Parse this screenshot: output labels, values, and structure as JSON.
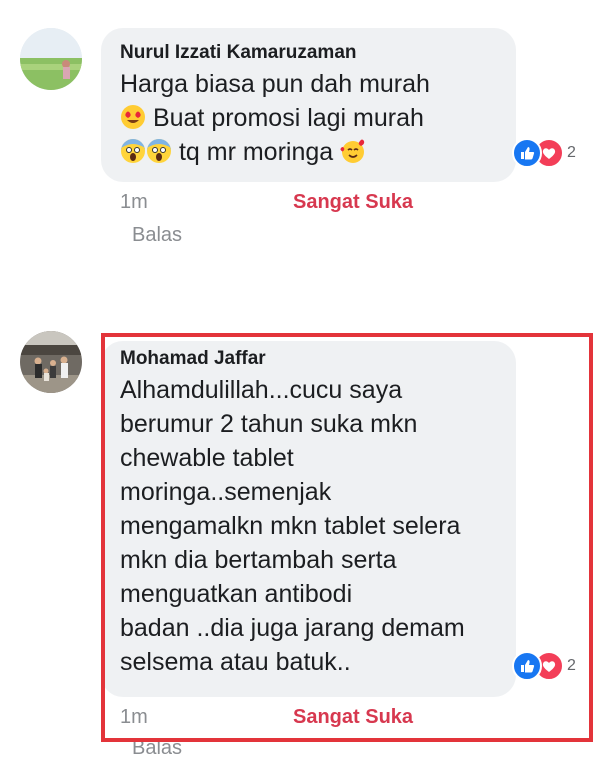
{
  "comments": [
    {
      "author": "Nurul Izzati Kamaruzaman",
      "lines": [
        "Harga biasa pun dah murah",
        "Buat promosi lagi murah",
        "tq mr moringa"
      ],
      "emojis": [
        "heart-eyes-emoji",
        "screaming-face-emoji",
        "smiling-hearts-emoji"
      ],
      "time": "1m",
      "reaction_label": "Sangat Suka",
      "reply_label": "Balas",
      "reaction_count": "2"
    },
    {
      "author": "Mohamad Jaffar",
      "lines": [
        "Alhamdulillah...cucu saya",
        "berumur 2 tahun suka mkn",
        "chewable tablet",
        "moringa..semenjak",
        "mengamalkn mkn tablet selera",
        "mkn dia bertambah serta",
        "menguatkan antibodi",
        "badan ..dia juga jarang demam",
        "selsema atau batuk.."
      ],
      "time": "1m",
      "reaction_label": "Sangat Suka",
      "reply_label": "Balas",
      "reaction_count": "2"
    }
  ],
  "colors": {
    "bubble": "#eff1f3",
    "like_blue": "#1877f2",
    "love_red": "#f33e58",
    "reacted_text": "#d7384f",
    "highlight_border": "#e3343a"
  }
}
